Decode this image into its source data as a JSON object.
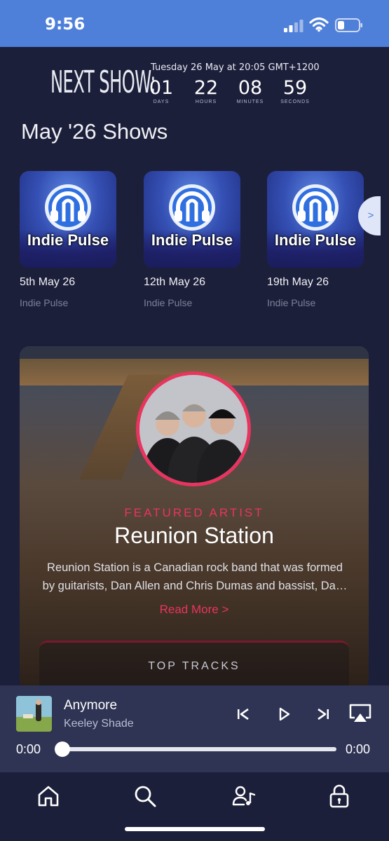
{
  "status_bar": {
    "time": "9:56"
  },
  "next_show": {
    "label": "NEXT SHOW:",
    "date_text": "Tuesday 26 May at 20:05 GMT+1200",
    "countdown": [
      {
        "value": "01",
        "unit": "DAYS"
      },
      {
        "value": "22",
        "unit": "HOURS"
      },
      {
        "value": "08",
        "unit": "MINUTES"
      },
      {
        "value": "59",
        "unit": "SECONDS"
      }
    ]
  },
  "shows_section": {
    "title": "May '26 Shows",
    "scroll_arrow": ">",
    "items": [
      {
        "logo_text": "Indie Pulse",
        "date": "5th May 26",
        "subtitle": "Indie Pulse"
      },
      {
        "logo_text": "Indie Pulse",
        "date": "12th May 26",
        "subtitle": "Indie Pulse"
      },
      {
        "logo_text": "Indie Pulse",
        "date": "19th May 26",
        "subtitle": "Indie Pulse"
      }
    ]
  },
  "featured": {
    "label": "FEATURED ARTIST",
    "name": "Reunion Station",
    "description": "Reunion Station is a Canadian rock band that was formed by guitarists, Dan Allen and Chris Dumas and bassist, Da…",
    "read_more": "Read More >",
    "top_tracks_title": "TOP TRACKS"
  },
  "player": {
    "title": "Anymore",
    "artist": "Keeley Shade",
    "elapsed": "0:00",
    "duration": "0:00",
    "progress_fraction": 0
  },
  "nav": {
    "icons": [
      "home-icon",
      "search-icon",
      "artists-icon",
      "lock-icon"
    ]
  },
  "colors": {
    "status_bar": "#4f80d9",
    "background": "#1c1f3a",
    "accent": "#e8345f",
    "player_bg": "#2f3454"
  }
}
